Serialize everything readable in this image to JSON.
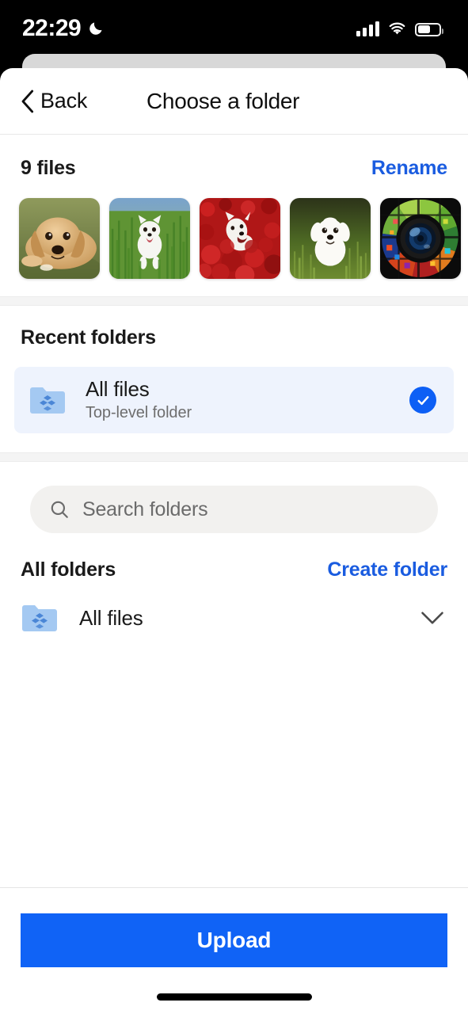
{
  "status_bar": {
    "time": "22:29",
    "icons": [
      "moon-icon",
      "cellular-signal-icon",
      "wifi-icon",
      "battery-icon"
    ],
    "battery_level_pct": 55
  },
  "nav": {
    "back_label": "Back",
    "back_icon": "chevron-left-icon",
    "title": "Choose a folder"
  },
  "files_section": {
    "count_label": "9 files",
    "rename_label": "Rename",
    "thumbnails": [
      {
        "name": "golden-retriever-puppy-on-grass"
      },
      {
        "name": "white-pomeranian-running-in-tall-grass"
      },
      {
        "name": "white-dog-in-red-flowers"
      },
      {
        "name": "white-maltese-puppy-in-grass"
      },
      {
        "name": "camera-lens-color-mosaic-icon"
      }
    ]
  },
  "recent_folders": {
    "title": "Recent folders",
    "items": [
      {
        "name": "All files",
        "subtitle": "Top-level folder",
        "icon": "dropbox-folder-icon",
        "selected": true,
        "check_icon": "check-circle-icon"
      }
    ]
  },
  "search": {
    "placeholder": "Search folders",
    "value": "",
    "icon": "search-icon"
  },
  "all_folders": {
    "title": "All folders",
    "create_label": "Create folder",
    "items": [
      {
        "name": "All files",
        "icon": "dropbox-folder-icon",
        "expand_icon": "chevron-down-icon"
      }
    ]
  },
  "footer": {
    "upload_label": "Upload"
  },
  "colors": {
    "accent_blue": "#1a5ce0",
    "button_blue": "#1063f6",
    "check_blue": "#0d5ff5",
    "selected_row_bg": "#eef3fd",
    "search_bg": "#f2f1ef",
    "folder_icon_blue": "#a4c9f2",
    "separator_band": "#f4f4f4"
  }
}
